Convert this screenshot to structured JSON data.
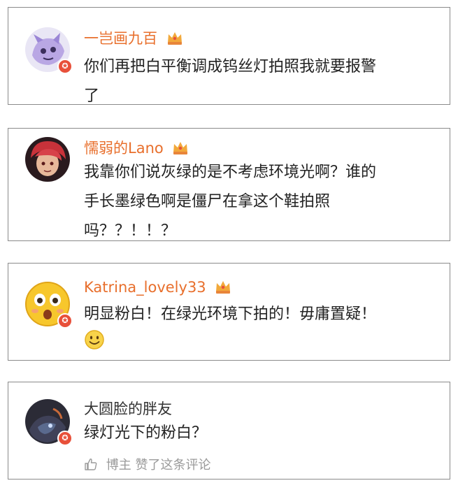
{
  "comments": [
    {
      "username": "一岂画九百",
      "text_lines": [
        "你们再把白平衡调成钨丝灯拍照我就要报警",
        "了"
      ],
      "avatar": "lavender-creature-avatar-icon",
      "badge": "verified-badge-icon",
      "crown": "crown-vip-icon"
    },
    {
      "username": "懦弱的Lano",
      "text_lines": [
        "我靠你们说灰绿的是不考虑环境光啊？谁的",
        "手长墨绿色啊是僵尸在拿这个鞋拍照",
        "吗？？！！？"
      ],
      "avatar": "red-hair-character-avatar-icon",
      "crown": "crown-vip-icon"
    },
    {
      "username": "Katrina_lovely33",
      "text_lines": [
        "明显粉白！在绿光环境下拍的！毋庸置疑！"
      ],
      "emoji": "smiley-face-icon",
      "avatar": "shocked-emoji-avatar-icon",
      "badge": "verified-badge-icon",
      "crown": "crown-vip-icon"
    },
    {
      "username": "大圆脸的胖友",
      "text_lines": [
        "绿灯光下的粉白？"
      ],
      "avatar": "dark-character-avatar-icon",
      "badge": "verified-badge-icon",
      "footer": "博主  赞了这条评论",
      "footer_icon": "thumbs-up-icon"
    }
  ],
  "colors": {
    "username": "#e86f2c",
    "username_plain": "#333333",
    "text": "#222222",
    "footer": "#9a9a9a",
    "badge": "#e8503a",
    "border": "#8a8a8a"
  }
}
